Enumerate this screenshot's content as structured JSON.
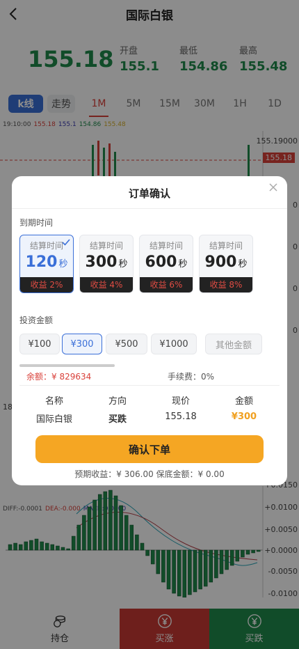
{
  "header": {
    "title": "国际白银"
  },
  "price": {
    "current": "155.18",
    "open_label": "开盘",
    "open": "155.1",
    "low_label": "最低",
    "low": "154.86",
    "high_label": "最高",
    "high": "155.48"
  },
  "tabs": [
    "k线",
    "走势",
    "1M",
    "5M",
    "15M",
    "30M",
    "1H",
    "1D"
  ],
  "chart": {
    "legend": {
      "time": "19:10:00",
      "v1": "155.18",
      "v2": "155.1",
      "v3": "154.86",
      "v4": "155.48"
    },
    "right_axis_top": "155.19000",
    "price_tag": "155.18",
    "left_label": "18",
    "macd_legend": {
      "diff": "DIFF:-0.0001",
      "dea": "DEA:-0.000",
      "macd": "MACD:0.0000"
    },
    "macd_axis": [
      "+0.0150",
      "+0.0100",
      "+0.0050",
      "+0.0000",
      "-0.0050",
      "-0.0100"
    ],
    "mid_axis": [
      "0",
      "0",
      "0",
      "0"
    ]
  },
  "bottom_bar": {
    "hold": "持仓",
    "buy_up": "买涨",
    "buy_down": "买跌"
  },
  "modal": {
    "title": "订单确认",
    "expiry_label": "到期时间",
    "time_options": [
      {
        "top": "结算时间",
        "num": "120",
        "unit": "秒",
        "profit": "收益 2%"
      },
      {
        "top": "结算时间",
        "num": "300",
        "unit": "秒",
        "profit": "收益 4%"
      },
      {
        "top": "结算时间",
        "num": "600",
        "unit": "秒",
        "profit": "收益 6%"
      },
      {
        "top": "结算时间",
        "num": "900",
        "unit": "秒",
        "profit": "收益 8%"
      }
    ],
    "invest_label": "投资金额",
    "amounts": [
      "¥100",
      "¥300",
      "¥500",
      "¥1000",
      "其他金额"
    ],
    "balance": "余额：¥ 829634",
    "fee": "手续费：0%",
    "info_headers": [
      "名称",
      "方向",
      "现价",
      "金额"
    ],
    "info_values": [
      "国际白银",
      "买跌",
      "155.18",
      "¥300"
    ],
    "confirm_label": "确认下单",
    "expected": "预期收益：¥ 306.00   保底金额：¥ 0.00"
  },
  "colors": {
    "green": "#1f8a4c",
    "red": "#d9403a",
    "blue": "#3a6fd8",
    "gold": "#f5a623"
  }
}
